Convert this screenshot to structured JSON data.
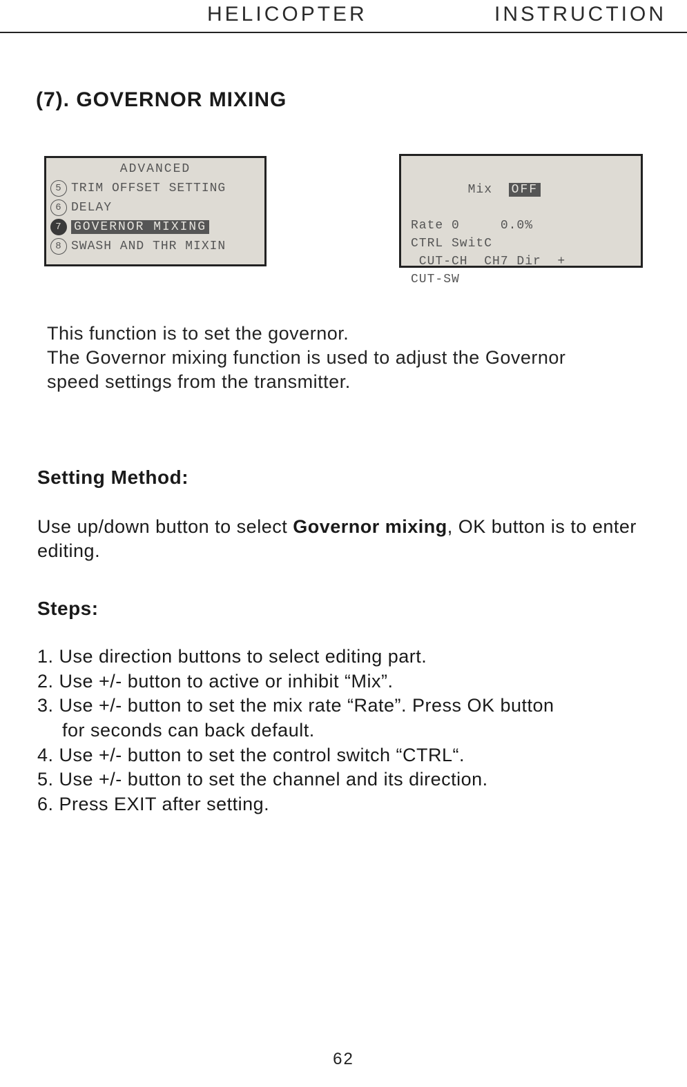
{
  "header": {
    "left": "HELICOPTER",
    "right": "INSTRUCTION"
  },
  "section_title": "(7). GOVERNOR MIXING",
  "lcd_left": {
    "title": "ADVANCED",
    "items": [
      {
        "num": "5",
        "label": "TRIM OFFSET SETTING",
        "selected": false
      },
      {
        "num": "6",
        "label": "DELAY",
        "selected": false
      },
      {
        "num": "7",
        "label": "GOVERNOR MIXING",
        "selected": true
      },
      {
        "num": "8",
        "label": "SWASH AND THR MIXIN",
        "selected": false
      }
    ]
  },
  "lcd_right": {
    "line1_label": "Mix",
    "line1_value": "OFF",
    "line2": "Rate 0     0.0%",
    "line3": "CTRL SwitC",
    "line4": " CUT-CH  CH7 Dir  +",
    "line5": "CUT-SW"
  },
  "intro": {
    "l1": "This function is to set the governor.",
    "l2": "The Governor mixing function is used to adjust the Governor",
    "l3": "speed settings from the transmitter."
  },
  "setting_method_heading": "Setting Method:",
  "setting_method_body_pre": "Use up/down button to select ",
  "setting_method_body_bold": "Governor mixing",
  "setting_method_body_post": ", OK button is to enter editing.",
  "steps_heading": "Steps:",
  "steps": {
    "s1": "1. Use direction buttons to select editing part.",
    "s2": "2. Use +/- button to active or inhibit “Mix”.",
    "s3a": "3. Use +/- button to set the mix rate “Rate”. Press OK button",
    "s3b": "for seconds can back default.",
    "s4": "4. Use +/- button to set the control switch “CTRL“.",
    "s5": "5. Use +/- button to set the channel and its direction.",
    "s6": "6. Press EXIT after setting."
  },
  "page_number": "62"
}
